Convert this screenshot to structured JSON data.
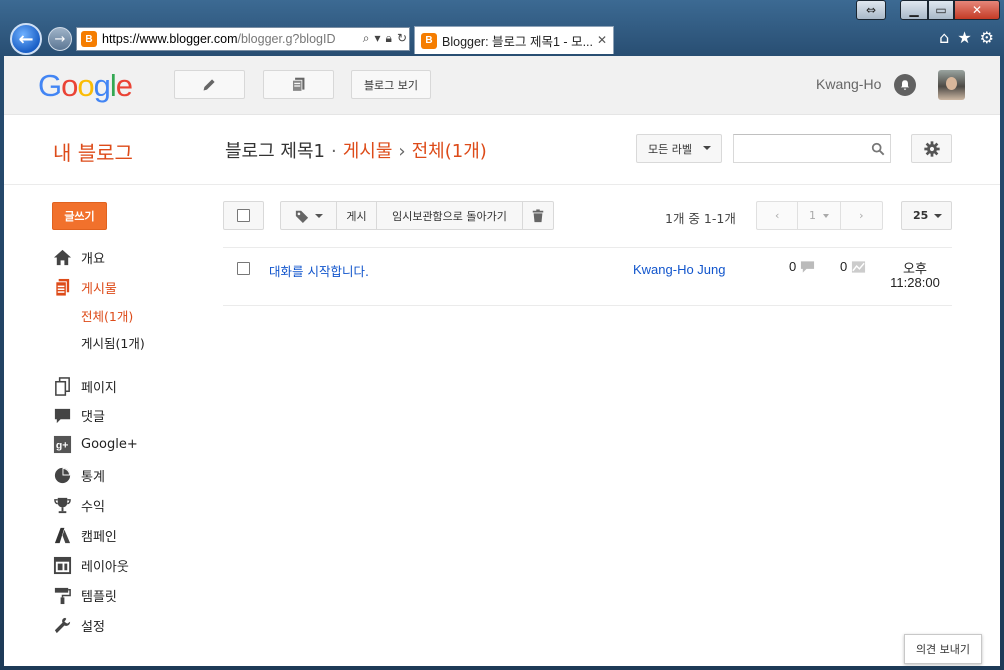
{
  "browser": {
    "url_host": "https://www.blogger.com",
    "url_rest": "/blogger.g?blogID",
    "tab_title": "Blogger: 블로그 제목1 - 모..."
  },
  "gbar": {
    "logo_letters": [
      "G",
      "o",
      "o",
      "g",
      "l",
      "e"
    ],
    "view_blog_label": "블로그 보기",
    "user_name": "Kwang-Ho"
  },
  "header": {
    "my_blog": "내 블로그",
    "blog_title": "블로그 제목1",
    "crumb_sep1": "·",
    "crumb_posts": "게시물",
    "crumb_sep2": "›",
    "crumb_all": "전체(1개)",
    "label_filter": "모든 라벨"
  },
  "sidebar": {
    "new_post": "글쓰기",
    "items": [
      {
        "label": "개요",
        "icon": "home-icon"
      },
      {
        "label": "게시물",
        "icon": "posts-icon"
      },
      {
        "label": "페이지",
        "icon": "pages-icon"
      },
      {
        "label": "댓글",
        "icon": "comment-icon"
      },
      {
        "label": "Google+",
        "icon": "google-plus-icon"
      },
      {
        "label": "통계",
        "icon": "stats-icon"
      },
      {
        "label": "수익",
        "icon": "trophy-icon"
      },
      {
        "label": "캠페인",
        "icon": "adwords-icon"
      },
      {
        "label": "레이아웃",
        "icon": "layout-icon"
      },
      {
        "label": "템플릿",
        "icon": "paint-roller-icon"
      },
      {
        "label": "설정",
        "icon": "wrench-icon"
      }
    ],
    "sub_items": [
      "전체(1개)",
      "게시됨(1개)"
    ]
  },
  "toolbar": {
    "publish": "게시",
    "revert": "임시보관함으로 돌아가기",
    "count_text": "1개 중 1-1개",
    "page_number": "1",
    "per_page": "25"
  },
  "posts": [
    {
      "title": "대화를 시작합니다.",
      "author": "Kwang-Ho Jung",
      "comments": "0",
      "views": "0",
      "date_line1": "오후",
      "date_line2": "11:28:00"
    }
  ],
  "feedback": "의견 보내기",
  "colors": {
    "accent": "#dd4b19",
    "new_post_button": "#f1712c",
    "link": "#1155cc"
  }
}
